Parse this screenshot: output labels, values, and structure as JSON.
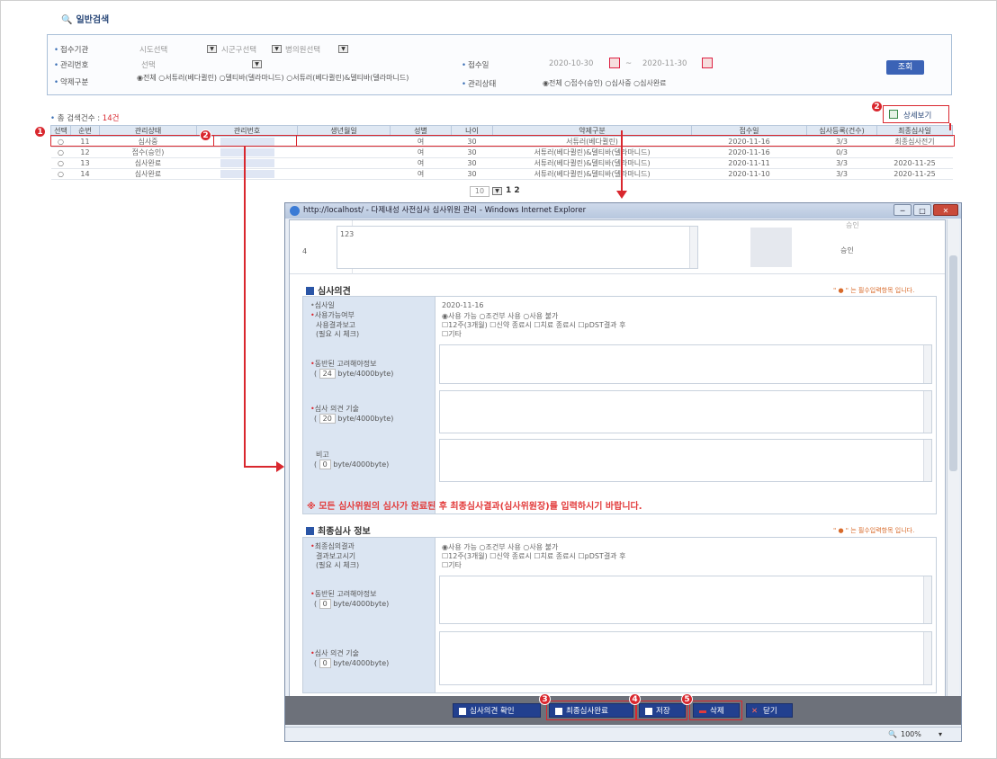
{
  "search": {
    "legend": "일반검색",
    "labels": {
      "agency": "접수기관",
      "manage_no": "관리번호",
      "drug_type": "약제구분",
      "receipt_date": "접수일",
      "manage_status": "관리상태"
    },
    "agency_selects": [
      "시도선택",
      "시군구선택",
      "병의원선택"
    ],
    "manage_no_select": "선택",
    "drug_type_options": [
      "전체",
      "서튜러(베다퀼린)",
      "델티바(델라마니드)",
      "서튜러(베다퀼린)&델티바(델라마니드)"
    ],
    "date_from": "2020-10-30",
    "date_to": "2020-11-30",
    "date_sep": "~",
    "status_options": [
      "전체",
      "접수(승인)",
      "심사중",
      "심사완료"
    ],
    "search_button": "조회"
  },
  "results": {
    "count_label": "총 검색건수 :",
    "count_value": "14건",
    "detail_button": "상세보기",
    "columns": [
      "선택",
      "순번",
      "관리상태",
      "관리번호",
      "생년월일",
      "성별",
      "나이",
      "약제구분",
      "접수일",
      "심사등록(건수)",
      "최종심사일"
    ],
    "rows": [
      {
        "no": "11",
        "status": "심사중",
        "gender": "여",
        "age": "30",
        "drug": "서튜러(베다퀼린)",
        "date": "2020-11-16",
        "count": "3/3",
        "final": "최종심사전기"
      },
      {
        "no": "12",
        "status": "접수(승인)",
        "gender": "여",
        "age": "30",
        "drug": "서튜러(베다퀼린)&델티바(델라마니드)",
        "date": "2020-11-16",
        "count": "0/3",
        "final": ""
      },
      {
        "no": "13",
        "status": "심사완료",
        "gender": "여",
        "age": "30",
        "drug": "서튜러(베다퀼린)&델티바(델라마니드)",
        "date": "2020-11-11",
        "count": "3/3",
        "final": "2020-11-25"
      },
      {
        "no": "14",
        "status": "심사완료",
        "gender": "여",
        "age": "30",
        "drug": "서튜러(베다퀼린)&델티바(델라마니드)",
        "date": "2020-11-10",
        "count": "3/3",
        "final": "2020-11-25"
      }
    ],
    "page_size": "10",
    "pages": [
      "1",
      "2"
    ]
  },
  "markers": [
    "1",
    "2",
    "2",
    "3",
    "4",
    "5"
  ],
  "popup": {
    "title": "http://localhost/ - 다제내성 사전심사 심사위원 관리 - Windows Internet Explorer",
    "top_row": {
      "no": "4",
      "text": "123",
      "result": "승인",
      "top_cut": "승인"
    },
    "review_section": {
      "title": "심사의견",
      "required_note": "\" ● \" 는 필수입력항목 입니다.",
      "date_label": "심사일",
      "date_value": "2020-11-16",
      "usable_label": "사용가능여부",
      "usable_options": [
        "사용 가능",
        "조건부 사용",
        "사용 불가"
      ],
      "report_label": [
        "사용결과보고",
        "(필요 시 체크)"
      ],
      "report_options": [
        "12주(3개월)",
        "신약 종료시",
        "치료 종료시",
        "pDST결과 후",
        "기타"
      ],
      "companion_label": "동반된 고려해야정보",
      "companion_bytes": "24",
      "opinion_label": "심사 의견 기술",
      "opinion_bytes": "20",
      "remark_label": "비고",
      "remark_bytes": "0",
      "bytes_open": "(",
      "bytes_suffix": "byte/4000byte)",
      "notice": "※ 모든 심사위원의 심사가 완료된 후 최종심사결과(심사위원장)를 입력하시기 바랍니다."
    },
    "final_section": {
      "title": "최종심사 정보",
      "required_note": "\" ● \" 는 필수입력항목 입니다.",
      "result_label": "최종심의결과",
      "result_options": [
        "사용 가능",
        "조건부 사용",
        "사용 불가"
      ],
      "report_label": [
        "결과보고시기",
        "(필요 시 체크)"
      ],
      "report_options": [
        "12주(3개월)",
        "신약 종료시",
        "치료 종료시",
        "pDST결과 후",
        "기타"
      ],
      "companion_label": "동반된 고려해야정보",
      "companion_bytes": "0",
      "opinion_label": "심사 의견 기술",
      "opinion_bytes": "0"
    },
    "buttons": {
      "confirm": "심사의견 확인",
      "final": "최종심사완료",
      "save": "저장",
      "delete": "삭제",
      "close": "닫기"
    },
    "zoom": "100%"
  },
  "colors": {
    "accent_red": "#d9272e",
    "header_blue": "#dfe8f3",
    "button_navy": "#22408f"
  }
}
